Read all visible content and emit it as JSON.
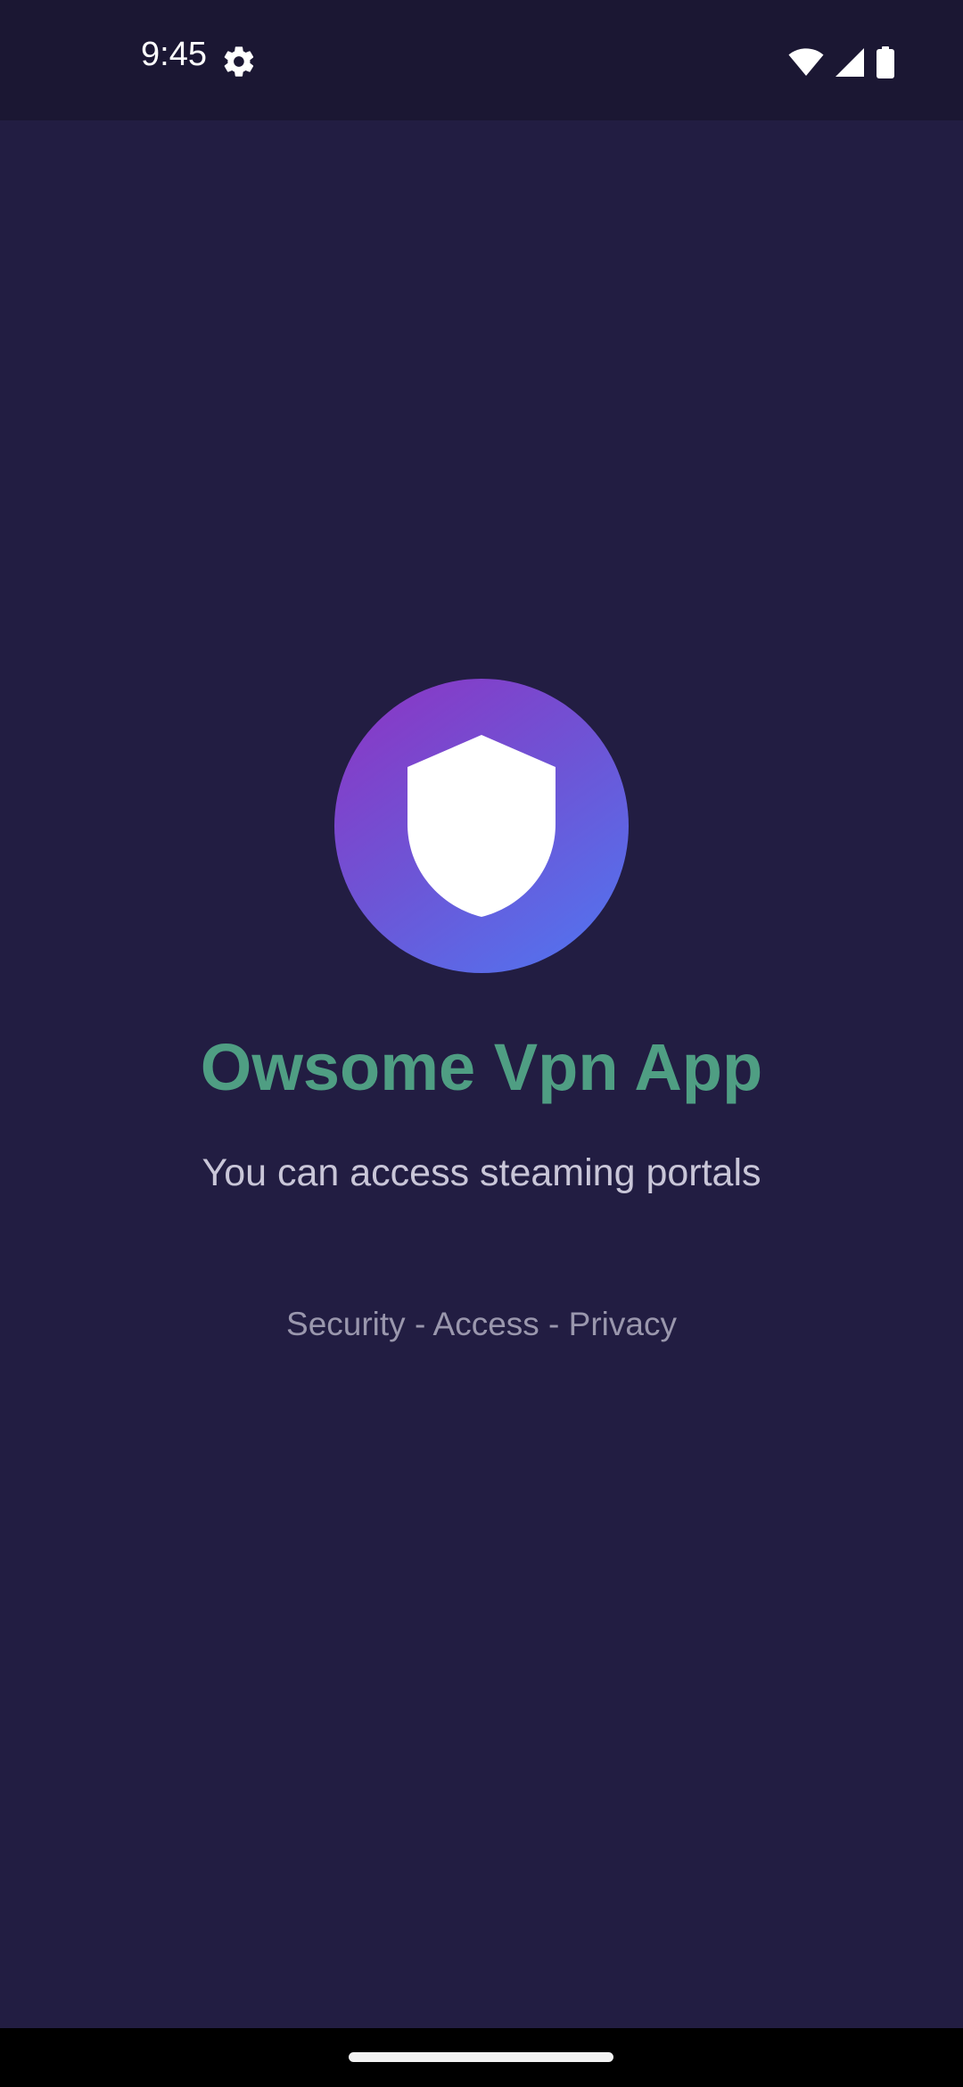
{
  "status_bar": {
    "time": "9:45",
    "icons": [
      "gear-icon",
      "wifi-icon",
      "cellular-signal-icon",
      "battery-icon"
    ]
  },
  "splash": {
    "logo_icon": "shield-icon",
    "title": "Owsome Vpn App",
    "subtitle": "You can access steaming portals",
    "tagline": "Security - Access - Privacy"
  },
  "colors": {
    "background": "#221d42",
    "status_bar_background": "#1b1733",
    "title": "#4f9e83",
    "subtitle": "#c9c6d8",
    "tagline": "#9a97ad",
    "logo_gradient_start": "#8d34c3",
    "logo_gradient_end": "#4f77f2"
  }
}
